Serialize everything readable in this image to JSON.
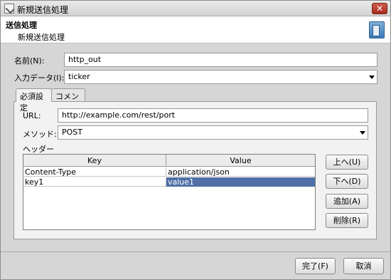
{
  "window": {
    "title": "新規送信処理",
    "close_label": "✕"
  },
  "header": {
    "title": "送信処理",
    "subtitle": "新規送信処理",
    "icon": "document-icon"
  },
  "form": {
    "name_label": "名前(N):",
    "name_value": "http_out",
    "input_data_label": "入力データ(I):",
    "input_data_value": "ticker"
  },
  "tabs": [
    {
      "label": "必須設定",
      "active": true
    },
    {
      "label": "コメント",
      "active": false
    }
  ],
  "required": {
    "url_label": "URL:",
    "url_value": "http://example.com/rest/port",
    "method_label": "メソッド:",
    "method_value": "POST",
    "header_label": "ヘッダー"
  },
  "headers_table": {
    "columns": [
      "Key",
      "Value"
    ],
    "rows": [
      {
        "key": "Content-Type",
        "value": "application/json"
      },
      {
        "key": "key1",
        "value": "value1"
      }
    ],
    "selected_row": 1
  },
  "side_buttons": {
    "up": "上へ(U)",
    "down": "下へ(D)",
    "add": "追加(A)",
    "delete": "削除(R)"
  },
  "footer": {
    "finish": "完了(F)",
    "cancel": "取消"
  }
}
